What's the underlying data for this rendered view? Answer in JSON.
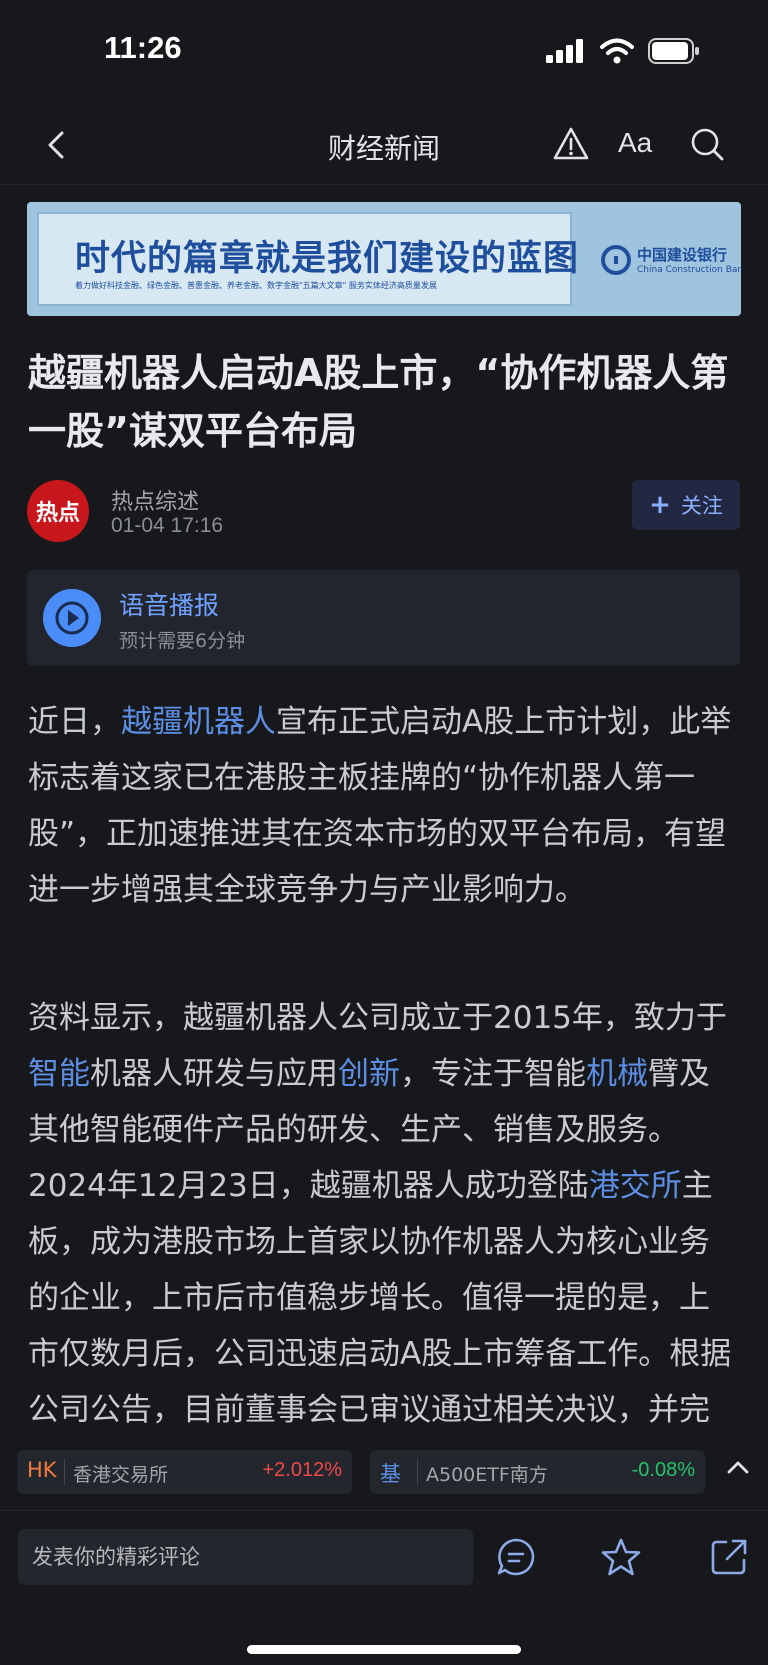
{
  "status": {
    "time": "11:26"
  },
  "nav": {
    "title": "财经新闻",
    "font_label": "Aa"
  },
  "banner": {
    "headline": "时代的篇章就是我们建设的蓝图",
    "subline": "着力做好科技金融、绿色金融、普惠金融、养老金融、数字金融\"五篇大文章\" 服务实体经济高质量发展",
    "bank_cn": "中国建设银行",
    "bank_en": "China Construction Bank"
  },
  "article": {
    "title": "越疆机器人启动A股上市，“协作机器人第一股”谋双平台布局",
    "author": {
      "avatar_text": "热点",
      "name": "热点综述",
      "time": "01-04 17:16"
    },
    "follow_label": "关注",
    "audio": {
      "title": "语音播报",
      "subtitle": "预计需要6分钟"
    },
    "p1": {
      "t1": "近日，",
      "link1": "越疆机器人",
      "t2": "宣布正式启动A股上市计划，此举标志着这家已在港股主板挂牌的“协作机器人第一股”，正加速推进其在资本市场的双平台布局，有望进一步增强其全球竞争力与产业影响力。"
    },
    "p2": {
      "t1": "资料显示，越疆机器人公司成立于2015年，致力于",
      "link1": "智能",
      "t2": "机器人研发与应用",
      "link2": "创新",
      "t3": "，专注于智能",
      "link3": "机械",
      "t4": "臂及其他智能硬件产品的研发、生产、销售及服务。2024年12月23日，越疆机器人成功登陆",
      "link4": "港交所",
      "t5": "主板，成为港股市场上首家以协作机器人为核心业务的企业，上市后市值稳步增长。值得一提的是，上市仅数月后，公司迅速启动A股上市筹备工作。根据公司公告，目前董事会已审议通过相关决议，并完成A股上市辅导备案登记。"
    }
  },
  "tickers": [
    {
      "code": "HK",
      "name": "香港交易所",
      "value": "+2.012%",
      "code_color": "#f07a3c",
      "value_color": "#f04a4a"
    },
    {
      "code": "基",
      "name": "A500ETF南方",
      "value": "-0.08%",
      "code_color": "#5c8ee4",
      "value_color": "#26c26a"
    }
  ],
  "comment": {
    "placeholder": "发表你的精彩评论"
  },
  "colors": {
    "background": "#17181c",
    "link": "#5c8ee4",
    "accent": "#4a8df6",
    "brand_red": "#c8161d"
  }
}
